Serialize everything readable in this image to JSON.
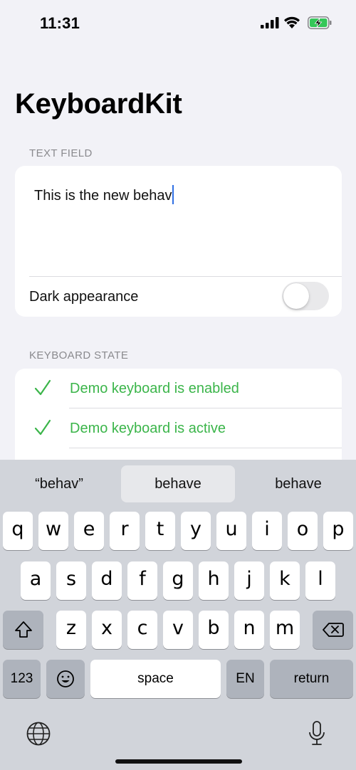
{
  "status_bar": {
    "time": "11:31"
  },
  "header": {
    "title": "KeyboardKit"
  },
  "text_field_section": {
    "header": "TEXT FIELD",
    "value": "This is the new behav",
    "toggle_label": "Dark appearance",
    "toggle_on": false
  },
  "keyboard_state_section": {
    "header": "KEYBOARD STATE",
    "rows": [
      {
        "label": "Demo keyboard is enabled"
      },
      {
        "label": "Demo keyboard is active"
      }
    ]
  },
  "keyboard": {
    "suggestions": [
      "“behav”",
      "behave",
      "behave"
    ],
    "row1": [
      "q",
      "w",
      "e",
      "r",
      "t",
      "y",
      "u",
      "i",
      "o",
      "p"
    ],
    "row2": [
      "a",
      "s",
      "d",
      "f",
      "g",
      "h",
      "j",
      "k",
      "l"
    ],
    "row3": [
      "z",
      "x",
      "c",
      "v",
      "b",
      "n",
      "m"
    ],
    "numbers_label": "123",
    "space_label": "space",
    "language_label": "EN",
    "return_label": "return"
  },
  "colors": {
    "accent_green": "#3bb54a",
    "caret_blue": "#2f6fe4"
  },
  "icons": [
    "signal-icon",
    "wifi-icon",
    "battery-charging-icon",
    "checkmark-icon",
    "shift-icon",
    "delete-icon",
    "emoji-icon",
    "globe-icon",
    "microphone-icon"
  ]
}
